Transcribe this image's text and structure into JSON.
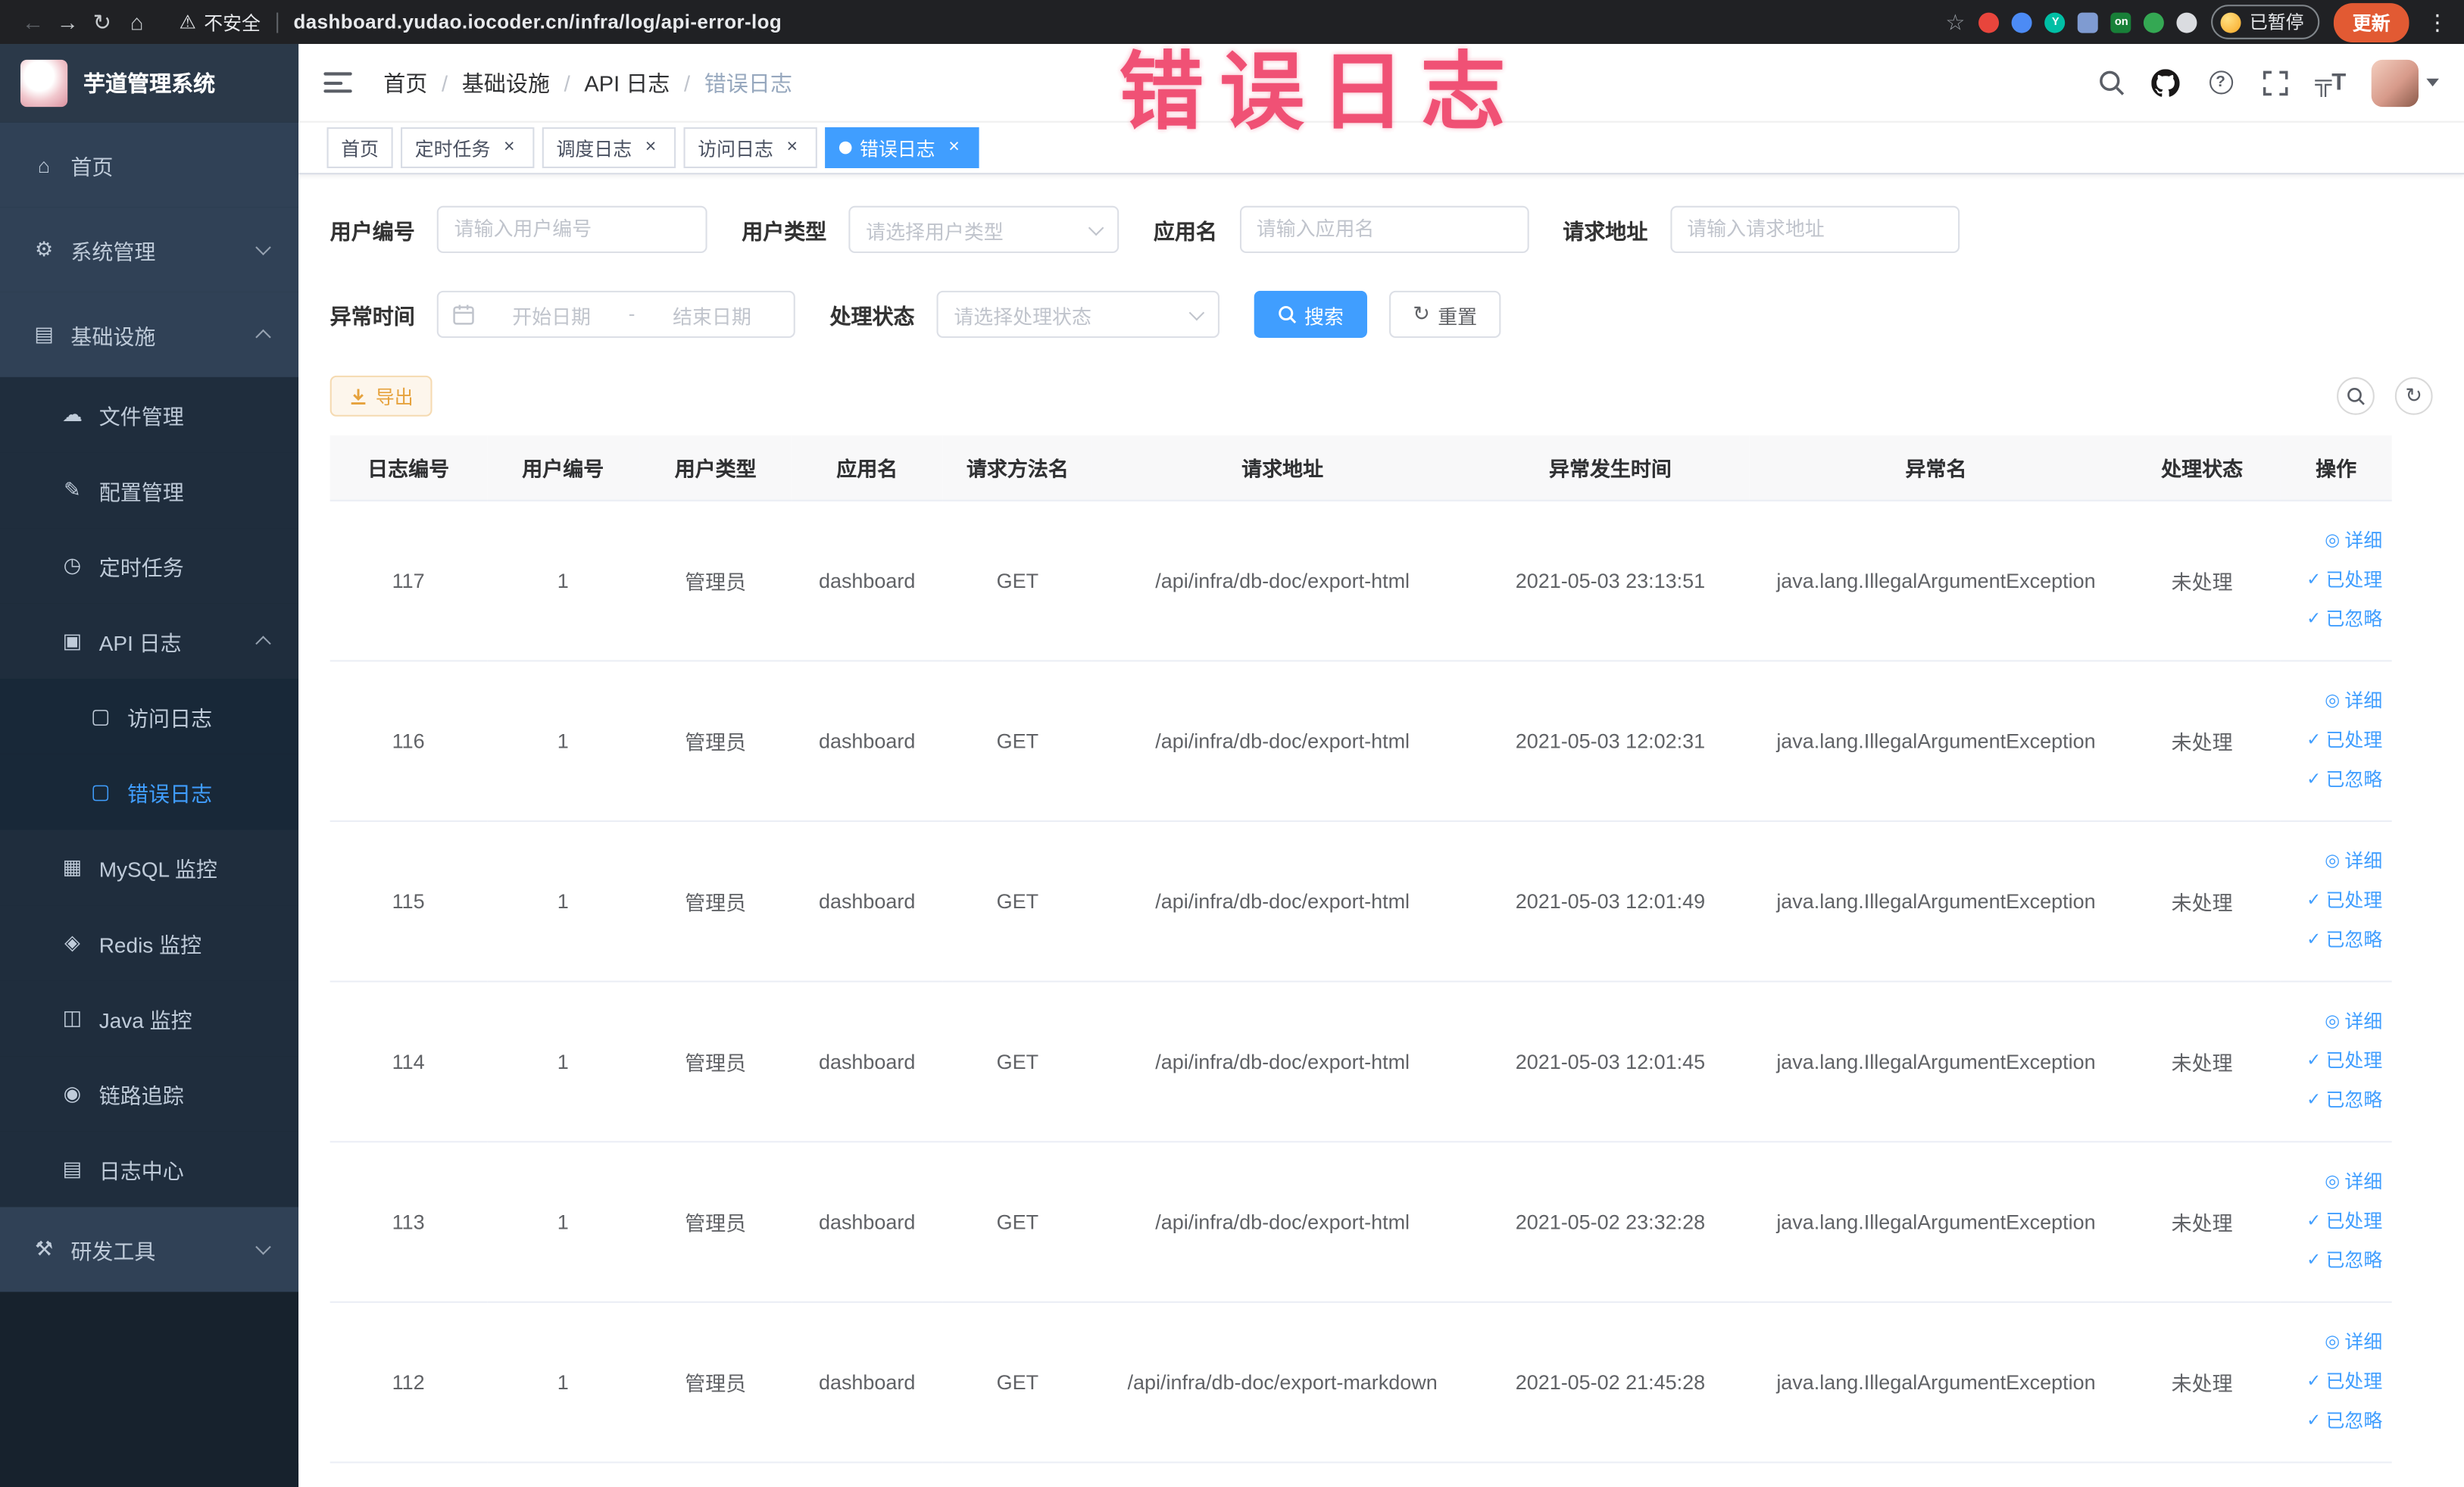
{
  "browser": {
    "security_label": "不安全",
    "url": "dashboard.yudao.iocoder.cn/infra/log/api-error-log",
    "paused_badge": "已暂停",
    "update_label": "更新",
    "extensions": [
      {
        "key": "ext-red-circle",
        "color": "#e8453c",
        "shape": "circle",
        "label": ""
      },
      {
        "key": "ext-blue-drop",
        "color": "#4c8bf5",
        "shape": "circle",
        "label": ""
      },
      {
        "key": "ext-teal-circle",
        "color": "#00bfa5",
        "shape": "circle",
        "label": "Y"
      },
      {
        "key": "ext-grid",
        "color": "#7f9bd1",
        "shape": "square",
        "label": ""
      },
      {
        "key": "ext-on-badge",
        "color": "#188038",
        "shape": "square",
        "label": "on"
      },
      {
        "key": "ext-leaf",
        "color": "#34a853",
        "shape": "circle",
        "label": ""
      },
      {
        "key": "ext-light-circle",
        "color": "#dadce0",
        "shape": "circle",
        "label": ""
      }
    ]
  },
  "annotation": "错误日志",
  "sidebar": {
    "logo_title": "芋道管理系统",
    "items": [
      {
        "key": "home",
        "label": "首页",
        "icon": "home-icon",
        "level": 1,
        "arrow": null,
        "active": false
      },
      {
        "key": "system-management",
        "label": "系统管理",
        "icon": "system-icon",
        "level": 1,
        "arrow": "down",
        "active": false
      },
      {
        "key": "infrastructure",
        "label": "基础设施",
        "icon": "infra-icon",
        "level": 1,
        "arrow": "up",
        "active": false
      },
      {
        "key": "file-management",
        "label": "文件管理",
        "icon": "file-icon",
        "level": 2,
        "arrow": null,
        "active": false
      },
      {
        "key": "config-management",
        "label": "配置管理",
        "icon": "config-icon",
        "level": 2,
        "arrow": null,
        "active": false
      },
      {
        "key": "scheduled-jobs",
        "label": "定时任务",
        "icon": "job-icon",
        "level": 2,
        "arrow": null,
        "active": false
      },
      {
        "key": "api-log",
        "label": "API 日志",
        "icon": "api-log-icon",
        "level": 2,
        "arrow": "up",
        "active": false
      },
      {
        "key": "access-log",
        "label": "访问日志",
        "icon": "access-log-icon",
        "level": 3,
        "arrow": null,
        "active": false
      },
      {
        "key": "error-log",
        "label": "错误日志",
        "icon": "error-log-icon",
        "level": 3,
        "arrow": null,
        "active": true
      },
      {
        "key": "mysql-monitor",
        "label": "MySQL 监控",
        "icon": "mysql-icon",
        "level": 2,
        "arrow": null,
        "active": false
      },
      {
        "key": "redis-monitor",
        "label": "Redis 监控",
        "icon": "redis-icon",
        "level": 2,
        "arrow": null,
        "active": false
      },
      {
        "key": "java-monitor",
        "label": "Java 监控",
        "icon": "java-icon",
        "level": 2,
        "arrow": null,
        "active": false
      },
      {
        "key": "trace",
        "label": "链路追踪",
        "icon": "trace-icon",
        "level": 2,
        "arrow": null,
        "active": false
      },
      {
        "key": "log-center",
        "label": "日志中心",
        "icon": "log-center-icon",
        "level": 2,
        "arrow": null,
        "active": false
      },
      {
        "key": "dev-tools",
        "label": "研发工具",
        "icon": "devtools-icon",
        "level": 1,
        "arrow": "down",
        "active": false
      }
    ]
  },
  "icon_glyphs": {
    "home-icon": "⌂",
    "system-icon": "⚙",
    "infra-icon": "▤",
    "file-icon": "☁",
    "config-icon": "✎",
    "job-icon": "◷",
    "api-log-icon": "▣",
    "access-log-icon": "▢",
    "error-log-icon": "▢",
    "mysql-icon": "▦",
    "redis-icon": "◈",
    "java-icon": "◫",
    "trace-icon": "◉",
    "log-center-icon": "▤",
    "devtools-icon": "⚒"
  },
  "breadcrumb": [
    "首页",
    "基础设施",
    "API 日志",
    "错误日志"
  ],
  "tabs": [
    {
      "key": "home",
      "label": "首页",
      "closable": false,
      "active": false
    },
    {
      "key": "scheduled-jobs",
      "label": "定时任务",
      "closable": true,
      "active": false
    },
    {
      "key": "job-log",
      "label": "调度日志",
      "closable": true,
      "active": false
    },
    {
      "key": "access-log",
      "label": "访问日志",
      "closable": true,
      "active": false
    },
    {
      "key": "error-log",
      "label": "错误日志",
      "closable": true,
      "active": true
    }
  ],
  "filters": {
    "user_id": {
      "label": "用户编号",
      "placeholder": "请输入用户编号",
      "value": ""
    },
    "user_type": {
      "label": "用户类型",
      "placeholder": "请选择用户类型",
      "value": ""
    },
    "app_name": {
      "label": "应用名",
      "placeholder": "请输入应用名",
      "value": ""
    },
    "request_url": {
      "label": "请求地址",
      "placeholder": "请输入请求地址",
      "value": ""
    },
    "exception_time": {
      "label": "异常时间",
      "start_placeholder": "开始日期",
      "separator": "-",
      "end_placeholder": "结束日期"
    },
    "process_status": {
      "label": "处理状态",
      "placeholder": "请选择处理状态",
      "value": ""
    },
    "search_label": "搜索",
    "reset_label": "重置"
  },
  "toolbar": {
    "export_label": "导出"
  },
  "table": {
    "columns": [
      "日志编号",
      "用户编号",
      "用户类型",
      "应用名",
      "请求方法名",
      "请求地址",
      "异常发生时间",
      "异常名",
      "处理状态",
      "操作"
    ],
    "actions": {
      "detail": "详细",
      "processed": "已处理",
      "ignored": "已忽略"
    },
    "rows": [
      {
        "id": "117",
        "user_id": "1",
        "user_type": "管理员",
        "app": "dashboard",
        "method": "GET",
        "url": "/api/infra/db-doc/export-html",
        "time": "2021-05-03 23:13:51",
        "exception": "java.lang.IllegalArgumentException",
        "status": "未处理"
      },
      {
        "id": "116",
        "user_id": "1",
        "user_type": "管理员",
        "app": "dashboard",
        "method": "GET",
        "url": "/api/infra/db-doc/export-html",
        "time": "2021-05-03 12:02:31",
        "exception": "java.lang.IllegalArgumentException",
        "status": "未处理"
      },
      {
        "id": "115",
        "user_id": "1",
        "user_type": "管理员",
        "app": "dashboard",
        "method": "GET",
        "url": "/api/infra/db-doc/export-html",
        "time": "2021-05-03 12:01:49",
        "exception": "java.lang.IllegalArgumentException",
        "status": "未处理"
      },
      {
        "id": "114",
        "user_id": "1",
        "user_type": "管理员",
        "app": "dashboard",
        "method": "GET",
        "url": "/api/infra/db-doc/export-html",
        "time": "2021-05-03 12:01:45",
        "exception": "java.lang.IllegalArgumentException",
        "status": "未处理"
      },
      {
        "id": "113",
        "user_id": "1",
        "user_type": "管理员",
        "app": "dashboard",
        "method": "GET",
        "url": "/api/infra/db-doc/export-html",
        "time": "2021-05-02 23:32:28",
        "exception": "java.lang.IllegalArgumentException",
        "status": "未处理"
      },
      {
        "id": "112",
        "user_id": "1",
        "user_type": "管理员",
        "app": "dashboard",
        "method": "GET",
        "url": "/api/infra/db-doc/export-markdown",
        "time": "2021-05-02 21:45:28",
        "exception": "java.lang.IllegalArgumentException",
        "status": "未处理"
      }
    ]
  },
  "colors": {
    "primary": "#409eff",
    "annotation": "#ee3a62",
    "sidebar_bg": "#304156",
    "warning_button_text": "#e6a23c"
  }
}
